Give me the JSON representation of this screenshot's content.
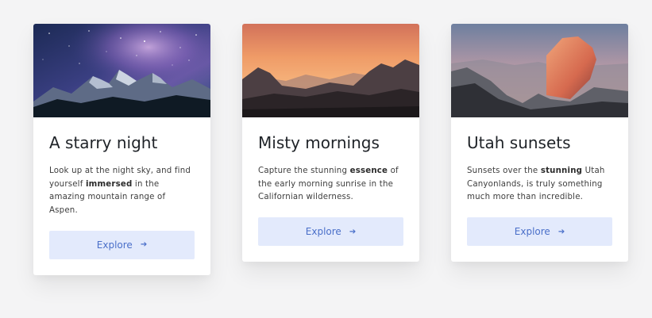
{
  "cards": [
    {
      "title": "A starry night",
      "text_parts": [
        "Look up at the night sky, and find yourself ",
        "immersed",
        " in the amazing mountain range of Aspen."
      ],
      "button_label": "Explore",
      "image": "starry-night-mountains"
    },
    {
      "title": "Misty mornings",
      "text_parts": [
        "Capture the stunning ",
        "essence",
        " of the early morning sunrise in the Californian wilderness."
      ],
      "button_label": "Explore",
      "image": "misty-sunrise-mountains"
    },
    {
      "title": "Utah sunsets",
      "text_parts": [
        "Sunsets over the ",
        "stunning",
        " Utah Canyonlands, is truly something much more than incredible."
      ],
      "button_label": "Explore",
      "image": "half-dome-sunset"
    }
  ],
  "icons": {
    "button_arrow": "arrow-right-icon"
  }
}
